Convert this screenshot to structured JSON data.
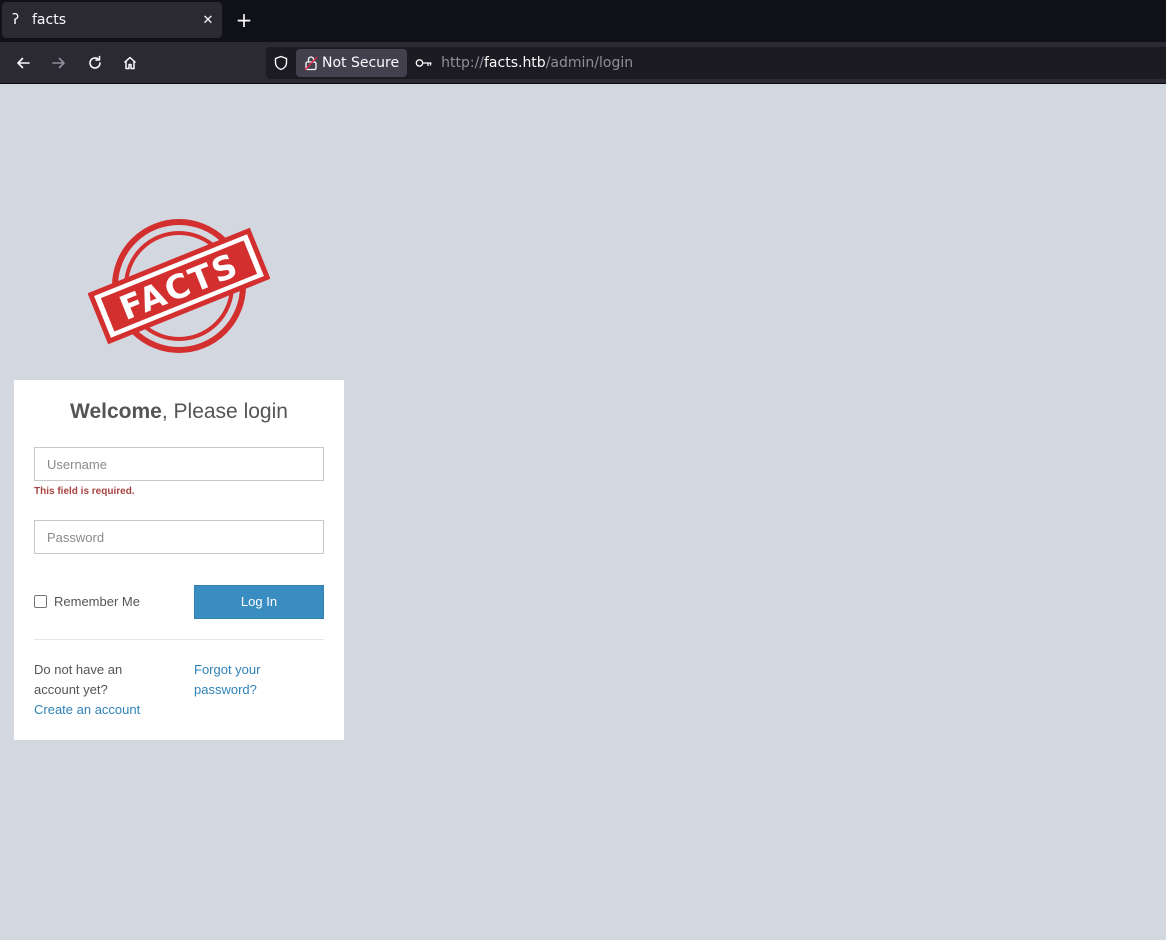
{
  "browser": {
    "tab": {
      "title": "facts",
      "favicon": "question-icon",
      "close_glyph": "✕"
    },
    "new_tab_glyph": "+",
    "security_label": "Not Secure",
    "url": {
      "scheme": "http://",
      "host": "facts.htb",
      "path": "/admin/login"
    }
  },
  "page": {
    "logo_text": "FACTS",
    "colors": {
      "background": "#d3d7e0",
      "logo_red": "#d32f2f",
      "button": "#3a8dc1",
      "link": "#2f82b8",
      "error": "#a94442"
    },
    "login": {
      "title_bold": "Welcome",
      "title_rest": ", Please login",
      "username_placeholder": "Username",
      "username_error": "This field is required.",
      "password_placeholder": "Password",
      "remember_label": "Remember Me",
      "login_button": "Log In",
      "no_account_text": "Do not have an account yet?",
      "create_account_link": "Create an account",
      "forgot_password_link": "Forgot your password?"
    }
  }
}
